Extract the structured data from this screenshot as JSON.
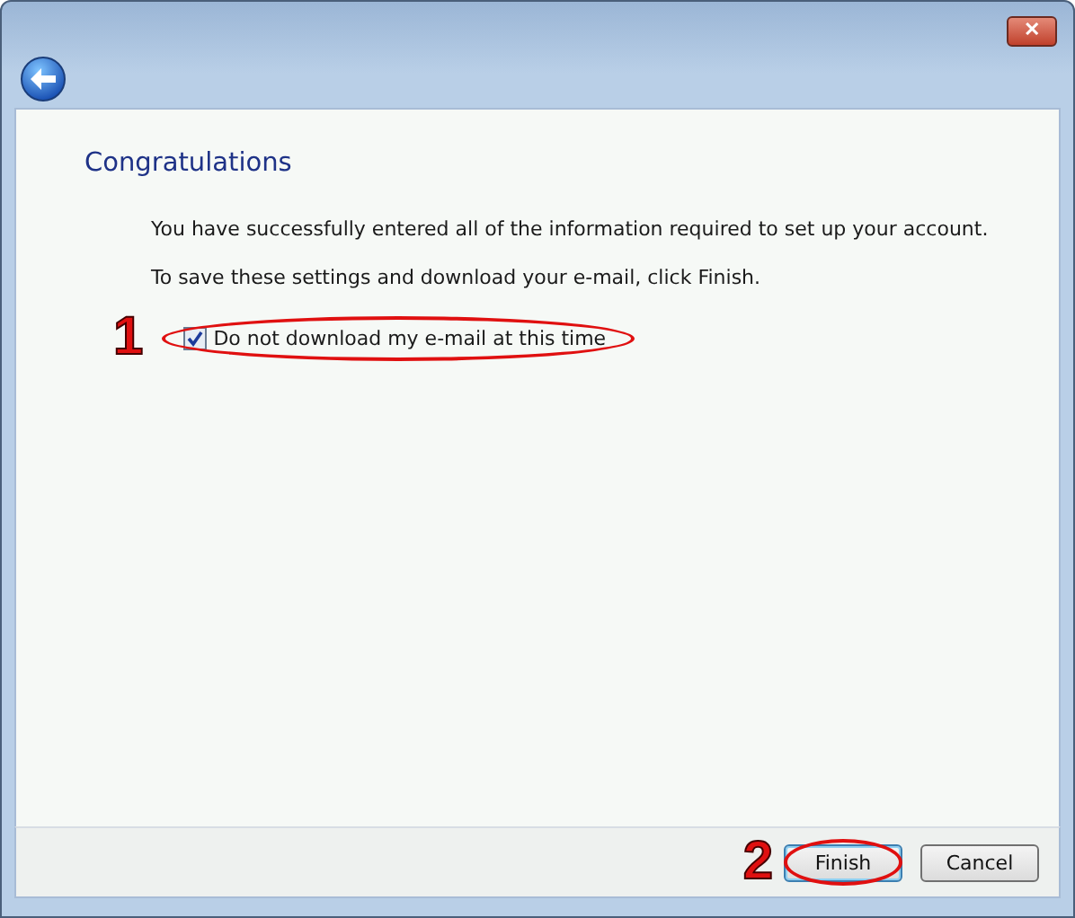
{
  "window": {
    "close_button": "✕"
  },
  "heading": "Congratulations",
  "paragraphs": [
    "You have successfully entered all of the information required to set up your account.",
    "To save these settings and download your e-mail, click Finish."
  ],
  "option": {
    "label": "Do not download my e-mail at this time",
    "checked": true,
    "annotation": "1"
  },
  "buttons": [
    {
      "label": "Finish",
      "default": true,
      "annotation": "2"
    },
    {
      "label": "Cancel",
      "default": false
    }
  ]
}
